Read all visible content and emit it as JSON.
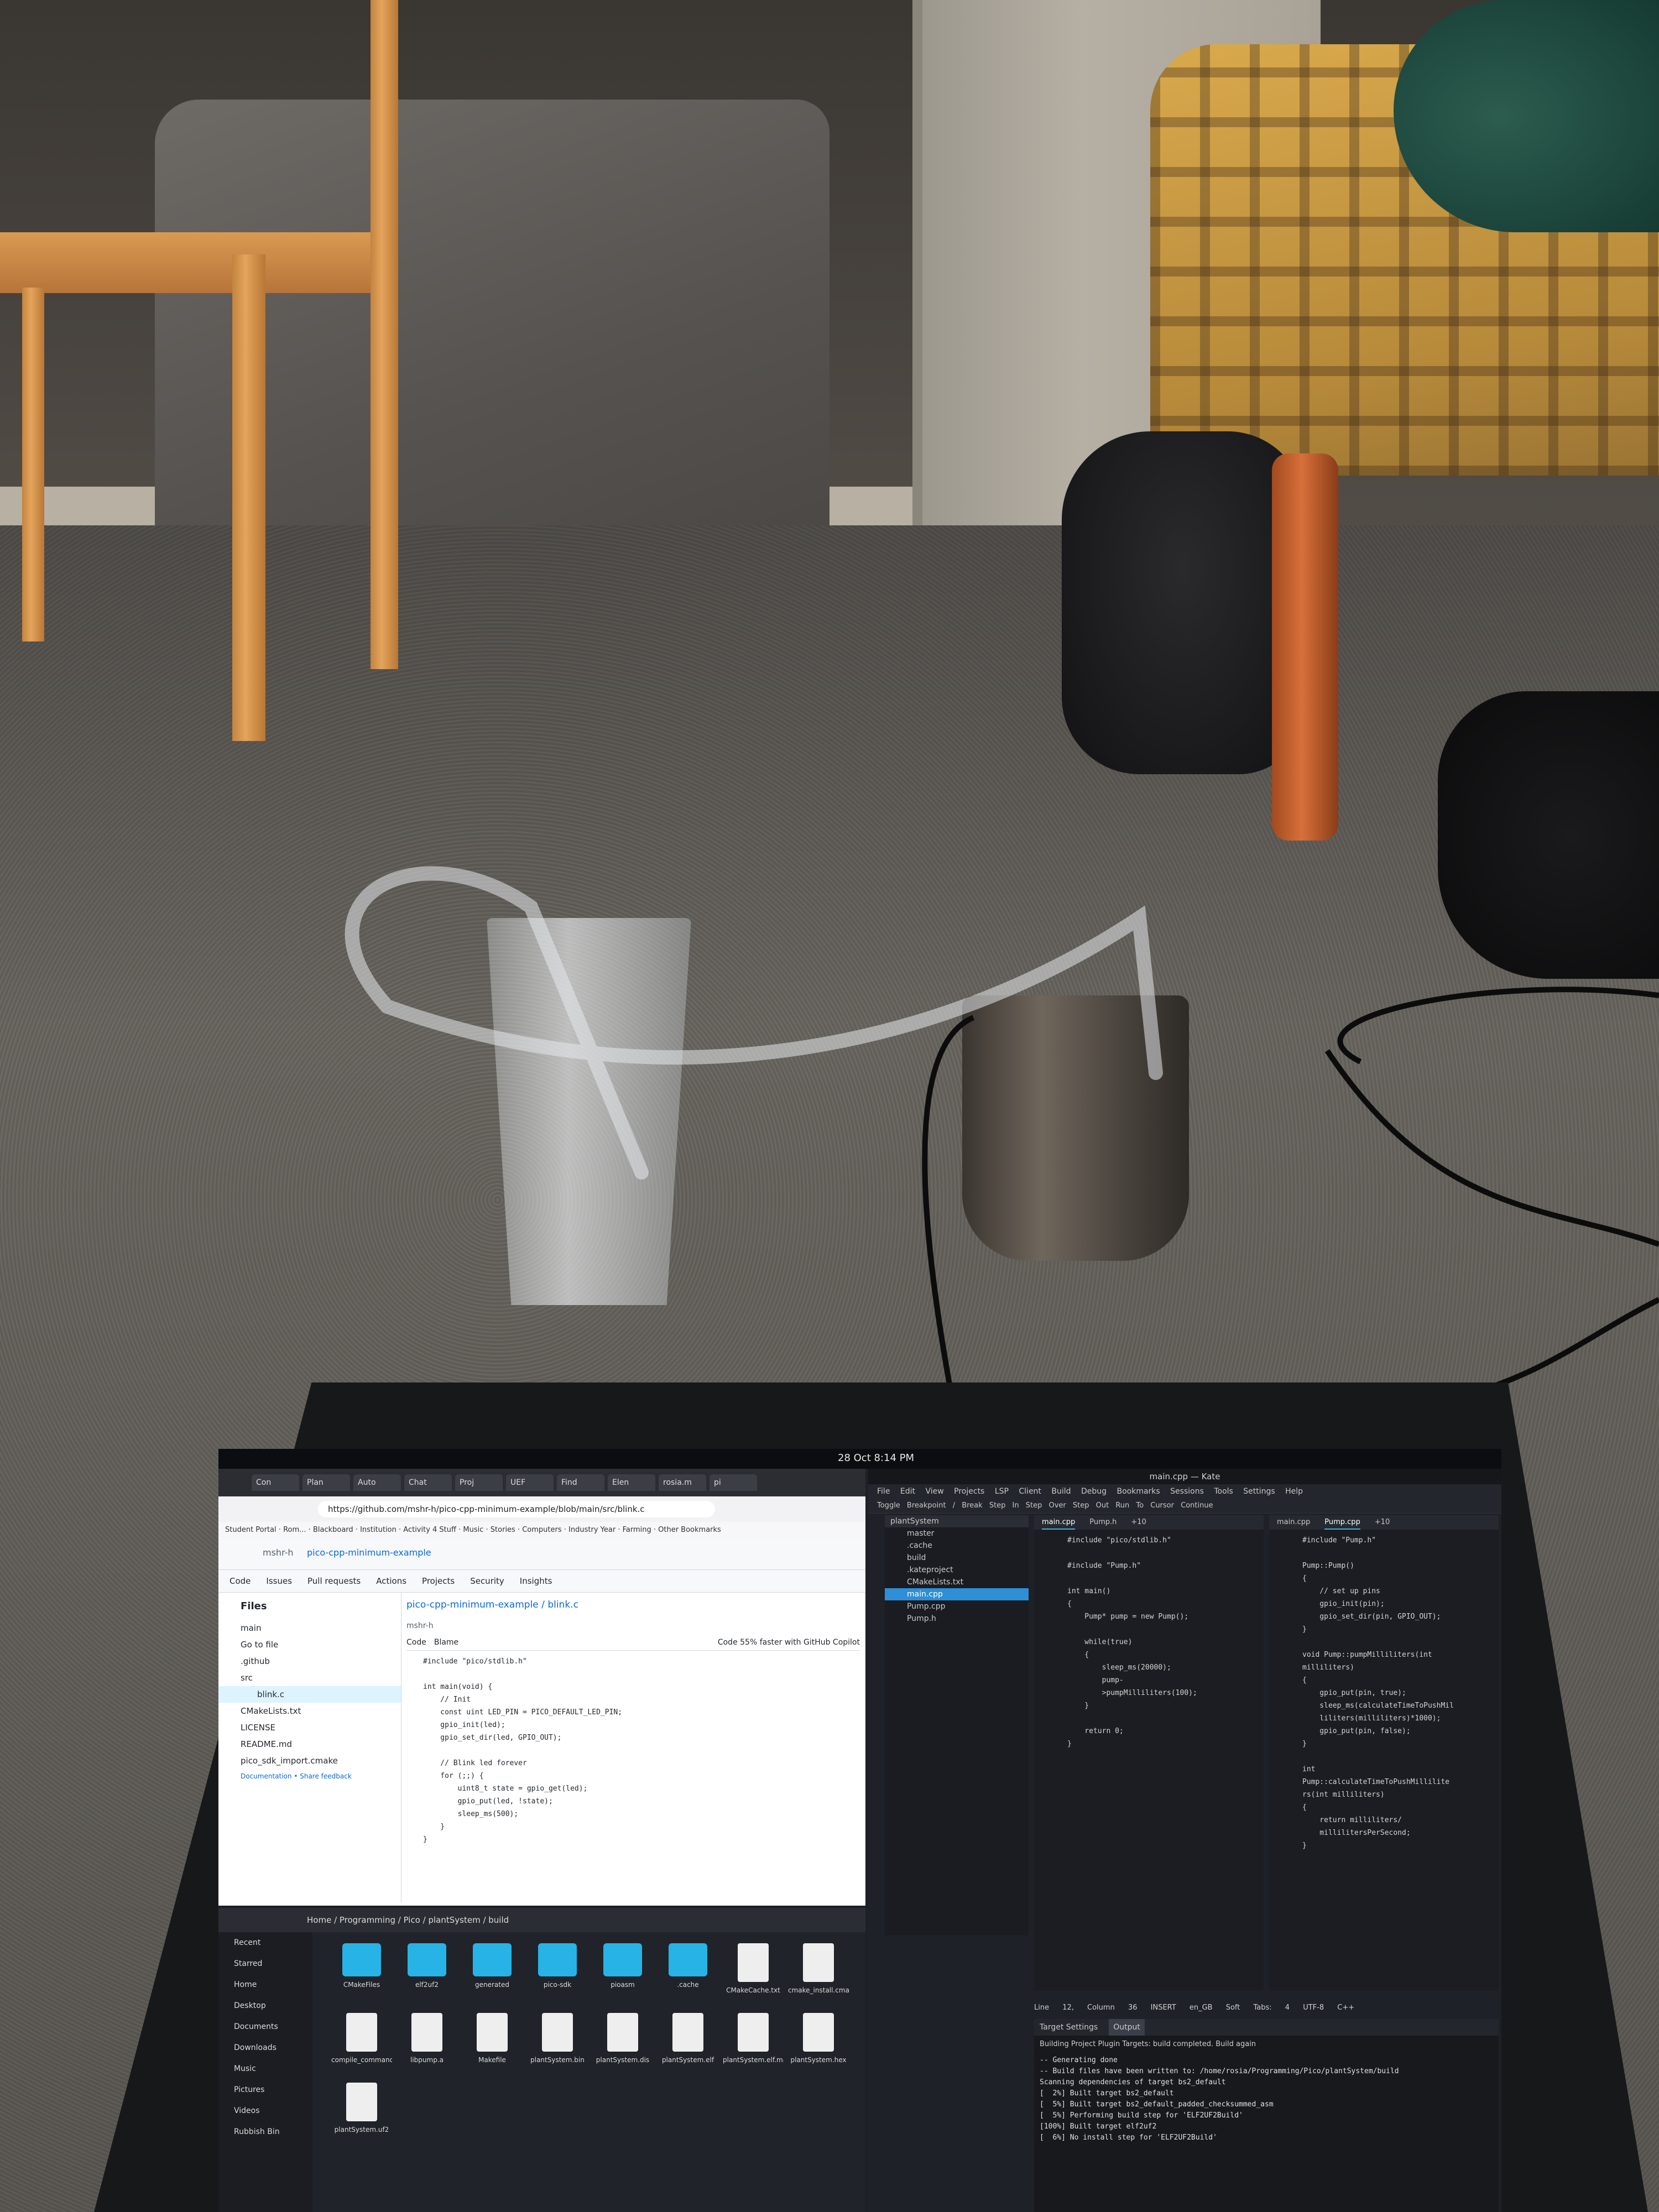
{
  "system_bar": {
    "clock": "28 Oct  8:14 PM"
  },
  "browser": {
    "tabs": [
      "Con",
      "Plan",
      "Auto",
      "Chat",
      "Proj",
      "UEF",
      "Find",
      "Elen",
      "rosia.m",
      "pi"
    ],
    "url": "https://github.com/mshr-h/pico-cpp-minimum-example/blob/main/src/blink.c",
    "bookmarks": [
      "Student Portal",
      "Rom...",
      "Blackboard",
      "Institution",
      "Activity 4 Stuff",
      "Music",
      "Stories",
      "Computers",
      "Industry Year",
      "Farming",
      "Other Bookmarks"
    ],
    "gh_owner": "mshr-h",
    "gh_repo": "pico-cpp-minimum-example",
    "gh_nav": [
      "Code",
      "Issues",
      "Pull requests",
      "Actions",
      "Projects",
      "Security",
      "Insights"
    ],
    "files_title": "Files",
    "branch": "main",
    "goto_file": "Go to file",
    "tree": [
      ".github",
      "src",
      "blink.c",
      "CMakeLists.txt",
      "LICENSE",
      "README.md",
      "pico_sdk_import.cmake"
    ],
    "footer_link": "Documentation • Share feedback",
    "breadcrumb_repo": "pico-cpp-minimum-example",
    "breadcrumb_file": "blink.c",
    "commit_author": "mshr-h",
    "code_tabs": [
      "Code",
      "Blame"
    ],
    "code_action": "Code 55% faster with GitHub Copilot",
    "code_lines": "#include \"pico/stdlib.h\"\n\nint main(void) {\n    // Init\n    const uint LED_PIN = PICO_DEFAULT_LED_PIN;\n    gpio_init(led);\n    gpio_set_dir(led, GPIO_OUT);\n\n    // Blink led forever\n    for (;;) {\n        uint8_t state = gpio_get(led);\n        gpio_put(led, !state);\n        sleep_ms(500);\n    }\n}"
  },
  "file_manager": {
    "path": "Home / Programming / Pico / plantSystem / build",
    "places": [
      "Recent",
      "Starred",
      "Home",
      "Desktop",
      "Documents",
      "Downloads",
      "Music",
      "Pictures",
      "Videos",
      "Rubbish Bin"
    ],
    "items": [
      {
        "name": "CMakeFiles",
        "kind": "folder"
      },
      {
        "name": "elf2uf2",
        "kind": "folder"
      },
      {
        "name": "generated",
        "kind": "folder"
      },
      {
        "name": "pico-sdk",
        "kind": "folder"
      },
      {
        "name": "pioasm",
        "kind": "folder"
      },
      {
        "name": ".cache",
        "kind": "folder"
      },
      {
        "name": "CMakeCache.txt",
        "kind": "doc"
      },
      {
        "name": "cmake_install.cmake",
        "kind": "doc"
      },
      {
        "name": "compile_commands.json",
        "kind": "doc"
      },
      {
        "name": "libpump.a",
        "kind": "doc"
      },
      {
        "name": "Makefile",
        "kind": "doc"
      },
      {
        "name": "plantSystem.bin",
        "kind": "doc"
      },
      {
        "name": "plantSystem.dis",
        "kind": "doc"
      },
      {
        "name": "plantSystem.elf",
        "kind": "doc"
      },
      {
        "name": "plantSystem.elf.map",
        "kind": "doc"
      },
      {
        "name": "plantSystem.hex",
        "kind": "doc"
      },
      {
        "name": "plantSystem.uf2",
        "kind": "doc"
      }
    ]
  },
  "kate": {
    "title": "main.cpp — Kate",
    "menu": [
      "File",
      "Edit",
      "View",
      "Projects",
      "LSP Client",
      "Build",
      "Debug",
      "Bookmarks",
      "Sessions",
      "Tools",
      "Settings",
      "Help"
    ],
    "debug_bar": [
      "Toggle Breakpoint / Break",
      "Step In",
      "Step Over",
      "Step Out",
      "Run To Cursor",
      "Continue"
    ],
    "project_root": "plantSystem",
    "project_tree": [
      "master",
      ".cache",
      "build",
      ".kateproject",
      "CMakeLists.txt",
      "main.cpp",
      "Pump.cpp",
      "Pump.h"
    ],
    "left_tabs": [
      "main.cpp",
      "Pump.h",
      "+10"
    ],
    "left_code": "#include \"pico/stdlib.h\"\n\n#include \"Pump.h\"\n\nint main()\n{\n    Pump* pump = new Pump();\n\n    while(true)\n    {\n        sleep_ms(20000);\n        pump-\n        >pumpMilliliters(100);\n    }\n\n    return 0;\n}",
    "right_tabs": [
      "main.cpp",
      "Pump.cpp",
      "+10"
    ],
    "right_code": "#include \"Pump.h\"\n\nPump::Pump()\n{\n    // set up pins\n    gpio_init(pin);\n    gpio_set_dir(pin, GPIO_OUT);\n}\n\nvoid Pump::pumpMilliliters(int\nmilliliters)\n{\n    gpio_put(pin, true);\n    sleep_ms(calculateTimeToPushMil\n    liliters(milliliters)*1000);\n    gpio_put(pin, false);\n}\n\nint\nPump::calculateTimeToPushMillilite\nrs(int milliliters)\n{\n    return milliliters/\n    millilitersPerSecond;\n}",
    "status": [
      "Line 12, Column 36",
      "INSERT",
      "en_GB",
      "Soft Tabs: 4",
      "UTF-8",
      "C++"
    ],
    "output_tabs": [
      "Target Settings",
      "Output"
    ],
    "output_status": "Building Project Plugin Targets: build completed. Build again",
    "output_lines": "-- Generating done\n-- Build files have been written to: /home/rosia/Programming/Pico/plantSystem/build\nScanning dependencies of target bs2_default\n[  2%] Built target bs2_default\n[  5%] Built target bs2_default_padded_checksummed_asm\n[  5%] Performing build step for 'ELF2UF2Build'\n[100%] Built target elf2uf2\n[  6%] No install step for 'ELF2UF2Build'"
  }
}
